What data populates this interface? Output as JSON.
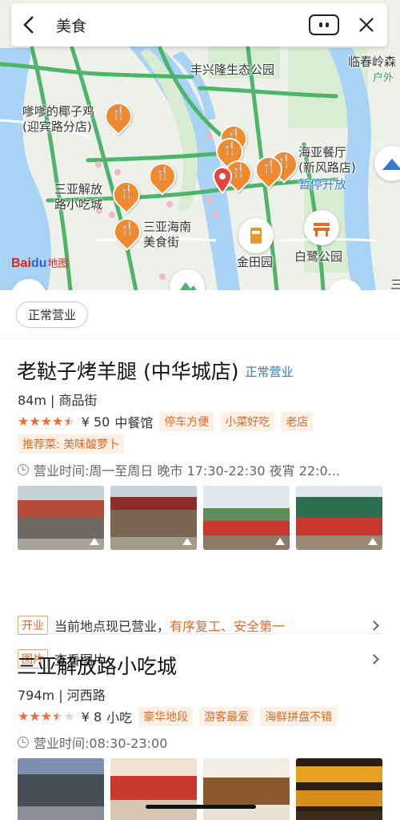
{
  "search": {
    "query": "美食"
  },
  "map": {
    "labels": {
      "park": "丰兴隆生态公园",
      "lincun": "临春岭森",
      "huwai": "户外",
      "coconut": "嗲嗲的椰子鸡\n(迎宾路分店)",
      "haiya": "海亚餐厅\n(新风路店)",
      "paused": "暂停开放",
      "jiefang": "三亚解放\n路小吃城",
      "hainan": "三亚海南\n美食街",
      "jintian": "金田园",
      "bailu": "白鹭公园",
      "edge": "三"
    },
    "logo": {
      "brand": "Bai",
      "paw": "du",
      "sub": "地图"
    }
  },
  "filter": {
    "label": "正常营业"
  },
  "results": [
    {
      "title": "老鞑子烤羊腿 (中华城店)",
      "status": "正常营业",
      "meta": "84m | 商品街",
      "rating": 4.5,
      "price": "¥ 50",
      "category": "中餐馆",
      "tags": [
        "停车方便",
        "小菜好吃",
        "老店"
      ],
      "recommend": "推荐菜: 美味酸萝卜",
      "hours": "营业时间:周一至周日 晚市 17:30-22:30 夜宵 22:0...",
      "open_badge": "开业",
      "open_text_a": "当前地点现已营业，",
      "open_text_b": "有序复工、安全第一",
      "photo_badge": "图片",
      "photo_text": "查看图片"
    },
    {
      "title": "三亚解放路小吃城",
      "meta": "794m | 河西路",
      "rating": 3.5,
      "price": "¥ 8",
      "category": "小吃",
      "tags": [
        "豪华地段",
        "游客最爱",
        "海鲜拼盘不错"
      ],
      "hours": "营业时间:08:30-23:00"
    }
  ],
  "colors": {
    "accent_orange": "#e06b2c",
    "pin_orange": "#ef8a2f",
    "link_blue": "#2f7bd8",
    "road_green": "#4db56a",
    "water_blue": "#a9d3f5"
  }
}
